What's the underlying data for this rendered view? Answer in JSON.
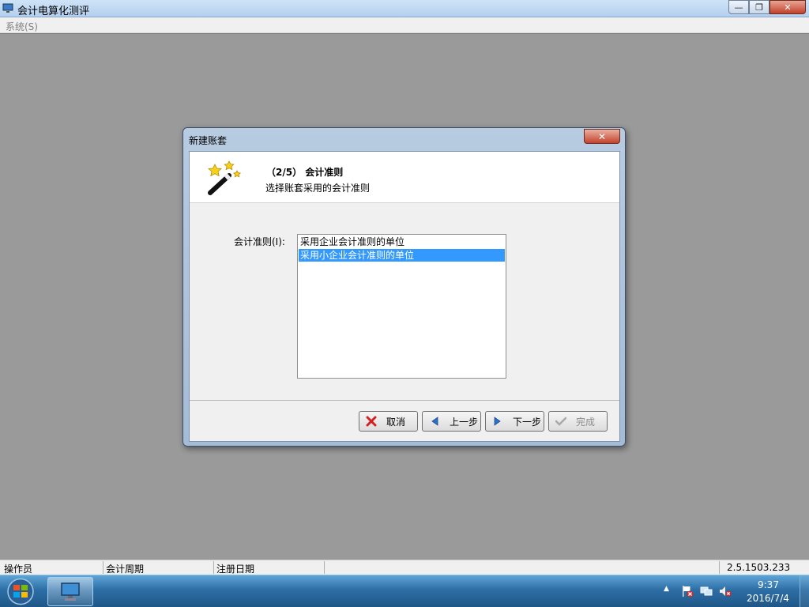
{
  "window": {
    "title": "会计电算化测评",
    "controls": {
      "minimize": "—",
      "restore": "❐",
      "close": "✕"
    }
  },
  "menu": {
    "system": "系统(S)"
  },
  "dialog": {
    "title": "新建账套",
    "close_glyph": "✕",
    "step_title": "（2/5） 会计准则",
    "step_desc": "选择账套采用的会计准则",
    "field_label": "会计准则(I):",
    "options": [
      {
        "label": "采用企业会计准则的单位",
        "selected": false
      },
      {
        "label": "采用小企业会计准则的单位",
        "selected": true
      }
    ],
    "buttons": {
      "cancel": "取消",
      "back": "上一步",
      "next": "下一步",
      "finish": "完成"
    }
  },
  "statusbar": {
    "operator": "操作员",
    "period": "会计周期",
    "reg_date": "注册日期",
    "version": "2.5.1503.233"
  },
  "taskbar": {
    "time": "9:37",
    "date": "2016/7/4",
    "tray_arrow": "▲"
  },
  "colors": {
    "selection": "#3399ff",
    "workspace": "#9a9a9a",
    "close_red": "#c4432c"
  }
}
